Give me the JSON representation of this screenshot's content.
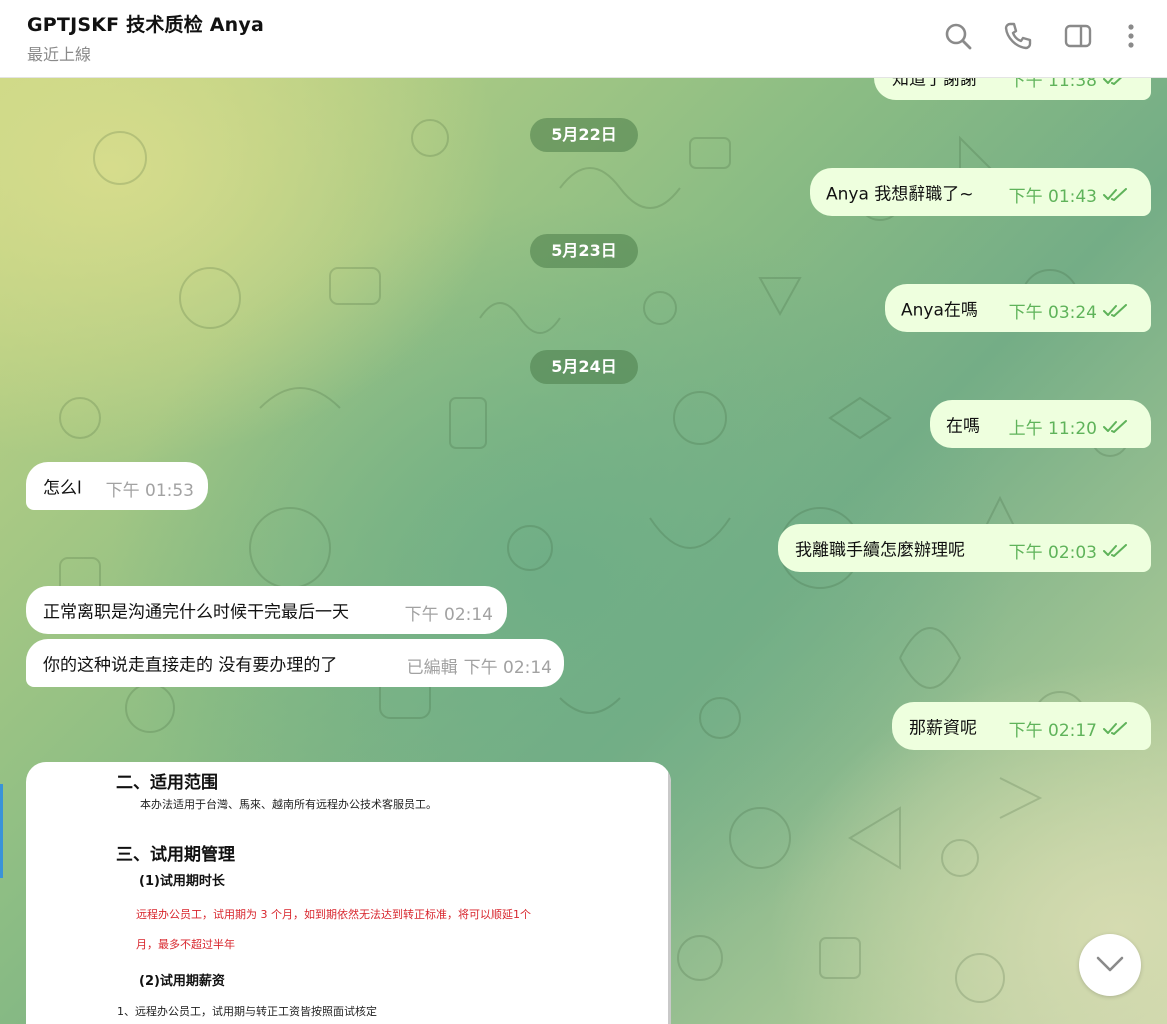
{
  "header": {
    "title": "GPTJSKF 技术质检 Anya",
    "status": "最近上線",
    "icons": [
      "search-icon",
      "phone-icon",
      "sidebar-toggle-icon",
      "more-vert-icon"
    ]
  },
  "colors": {
    "outgoing_bubble": "#eeffde",
    "incoming_bubble": "#ffffff",
    "read_ticks": "#5fb35a",
    "date_pill": "#4a7c48"
  },
  "messages": {
    "m0": {
      "text": "知道了謝謝",
      "time": "下午 11:38"
    },
    "d1": "5月22日",
    "m1": {
      "text": "Anya 我想辭職了~",
      "time": "下午 01:43"
    },
    "d2": "5月23日",
    "m2": {
      "text": "Anya在嗎",
      "time": "下午 03:24"
    },
    "d3": "5月24日",
    "m3": {
      "text": "在嗎",
      "time": "上午 11:20"
    },
    "m4": {
      "text": "怎么l",
      "time": "下午 01:53"
    },
    "m5": {
      "text": "我離職手續怎麼辦理呢",
      "time": "下午 02:03"
    },
    "m6": {
      "text": "正常离职是沟通完什么时候干完最后一天",
      "time": "下午 02:14"
    },
    "m7": {
      "text": "你的这种说走直接走的   没有要办理的了",
      "edited": "已編輯",
      "time": "下午 02:14"
    },
    "m8": {
      "text": "那薪資呢",
      "time": "下午 02:17"
    }
  },
  "document": {
    "heading_scope": "二、适用范围",
    "scope_text": "本办法适用于台灣、馬來、越南所有远程办公技术客服员工。",
    "heading_probation": "三、试用期管理",
    "sub1": "(1)试用期时长",
    "red1": "远程办公员工，试用期为 3 个月，如到期依然无法达到转正标准，将可以顺延1个",
    "red2": "月，最多不超过半年",
    "sub2": "(2)试用期薪资",
    "item1": "1、远程办公员工，试用期与转正工资皆按照面试核定"
  }
}
